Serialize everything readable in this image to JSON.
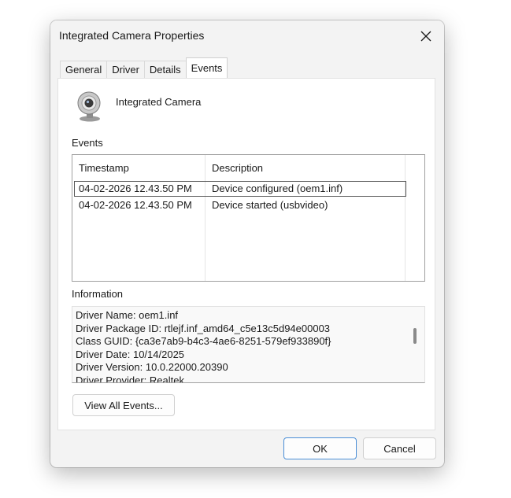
{
  "window": {
    "title": "Integrated Camera Properties",
    "close_icon": "close-icon"
  },
  "tabs": [
    {
      "label": "General",
      "active": false
    },
    {
      "label": "Driver",
      "active": false
    },
    {
      "label": "Details",
      "active": false
    },
    {
      "label": "Events",
      "active": true
    }
  ],
  "device": {
    "icon": "webcam-icon",
    "name": "Integrated Camera"
  },
  "events": {
    "section_label": "Events",
    "columns": [
      "Timestamp",
      "Description"
    ],
    "rows": [
      {
        "timestamp": "04-02-2026 12.43.50 PM",
        "description": "Device configured (oem1.inf)",
        "selected": true
      },
      {
        "timestamp": "04-02-2026 12.43.50 PM",
        "description": "Device started (usbvideo)",
        "selected": false
      }
    ]
  },
  "information": {
    "section_label": "Information",
    "lines": [
      "Driver Name: oem1.inf",
      "Driver Package ID: rtlejf.inf_amd64_c5e13c5d94e00003",
      "Class GUID: {ca3e7ab9-b4c3-4ae6-8251-579ef933890f}",
      "Driver Date: 10/14/2025",
      "Driver Version: 10.0.22000.20390",
      "Driver Provider: Realtek"
    ]
  },
  "buttons": {
    "view_all_events": "View All Events...",
    "ok": "OK",
    "cancel": "Cancel"
  },
  "colors": {
    "accent_border": "#4a8ed6",
    "window_bg": "#f3f3f3"
  }
}
